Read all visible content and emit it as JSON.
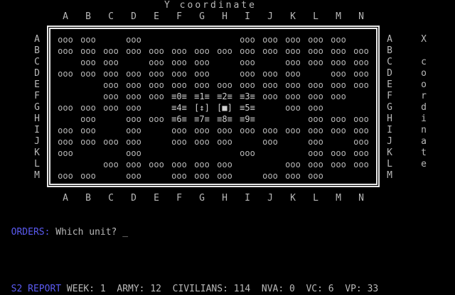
{
  "title": "Y coordinate",
  "columns": [
    "A",
    "B",
    "C",
    "D",
    "E",
    "F",
    "G",
    "H",
    "I",
    "J",
    "K",
    "L",
    "M",
    "N"
  ],
  "rows": [
    "A",
    "B",
    "C",
    "D",
    "E",
    "F",
    "G",
    "H",
    "I",
    "J",
    "K",
    "L",
    "M"
  ],
  "x_axis_label": [
    "X",
    " ",
    "c",
    "o",
    "o",
    "r",
    "d",
    "i",
    "n",
    "a",
    "t",
    "e"
  ],
  "grid": [
    [
      "ooo",
      "ooo",
      "",
      "ooo",
      "",
      "",
      "",
      "",
      "ooo",
      "ooo",
      "ooo",
      "ooo",
      "ooo",
      ""
    ],
    [
      "ooo",
      "ooo",
      "ooo",
      "ooo",
      "ooo",
      "ooo",
      "ooo",
      "ooo",
      "ooo",
      "ooo",
      "ooo",
      "ooo",
      "ooo",
      "ooo"
    ],
    [
      "",
      "ooo",
      "ooo",
      "",
      "ooo",
      "ooo",
      "ooo",
      "",
      "ooo",
      "",
      "ooo",
      "ooo",
      "ooo",
      "ooo"
    ],
    [
      "ooo",
      "ooo",
      "ooo",
      "ooo",
      "ooo",
      "ooo",
      "ooo",
      "",
      "ooo",
      "ooo",
      "ooo",
      "",
      "ooo",
      "ooo"
    ],
    [
      "",
      "",
      "ooo",
      "ooo",
      "ooo",
      "ooo",
      "ooo",
      "ooo",
      "ooo",
      "ooo",
      "ooo",
      "ooo",
      "ooo",
      "ooo"
    ],
    [
      "",
      "",
      "ooo",
      "ooo",
      "ooo",
      "≡0≡",
      "≡1≡",
      "≡2≡",
      "≡3≡",
      "ooo",
      "ooo",
      "ooo",
      "ooo",
      ""
    ],
    [
      "ooo",
      "ooo",
      "ooo",
      "ooo",
      "",
      "≡4≡",
      "[↕]",
      "[■]",
      "≡5≡",
      "",
      "ooo",
      "ooo",
      "",
      ""
    ],
    [
      "",
      "ooo",
      "",
      "ooo",
      "ooo",
      "≡6≡",
      "≡7≡",
      "≡8≡",
      "≡9≡",
      "",
      "",
      "ooo",
      "ooo",
      "ooo"
    ],
    [
      "ooo",
      "ooo",
      "",
      "ooo",
      "",
      "ooo",
      "ooo",
      "ooo",
      "ooo",
      "ooo",
      "ooo",
      "ooo",
      "ooo",
      "ooo"
    ],
    [
      "ooo",
      "ooo",
      "ooo",
      "ooo",
      "",
      "ooo",
      "ooo",
      "ooo",
      "",
      "ooo",
      "",
      "ooo",
      "",
      "ooo"
    ],
    [
      "ooo",
      "",
      "",
      "ooo",
      "",
      "",
      "",
      "",
      "ooo",
      "",
      "",
      "ooo",
      "ooo",
      "ooo"
    ],
    [
      "",
      "",
      "ooo",
      "ooo",
      "ooo",
      "ooo",
      "ooo",
      "ooo",
      "",
      "",
      "ooo",
      "ooo",
      "ooo",
      "ooo"
    ],
    [
      "ooo",
      "ooo",
      "",
      "ooo",
      "",
      "ooo",
      "ooo",
      "ooo",
      "",
      "ooo",
      "ooo",
      "ooo",
      "",
      ""
    ]
  ],
  "orders": {
    "label": "ORDERS:",
    "prompt": " Which unit? ",
    "cursor": "_"
  },
  "status": {
    "label": "S2 REPORT",
    "text": " WEEK: 1  ARMY: 12  CIVILIANS: 114  NVA: 0  VC: 6  VP: 33"
  },
  "colors": {
    "background": "#000000",
    "text": "#b8b8b8",
    "accent": "#5a5af0"
  }
}
